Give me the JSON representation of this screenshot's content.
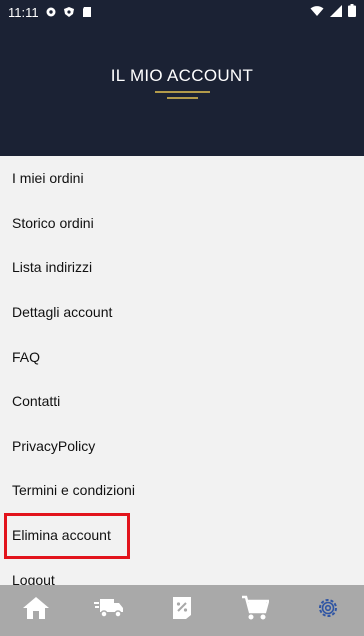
{
  "status_bar": {
    "time": "11:11",
    "icons_left": [
      "settings-icon",
      "shield-icon",
      "sd-card-icon"
    ],
    "icons_right": [
      "wifi-icon",
      "signal-icon",
      "battery-icon"
    ]
  },
  "header": {
    "title": "IL MIO ACCOUNT",
    "accent_color": "#b39b4a",
    "background_color": "#1b2234"
  },
  "menu": {
    "items": [
      {
        "label": "I miei ordini"
      },
      {
        "label": "Storico ordini"
      },
      {
        "label": "Lista indirizzi"
      },
      {
        "label": "Dettagli account"
      },
      {
        "label": "FAQ"
      },
      {
        "label": "Contatti"
      },
      {
        "label": "PrivacyPolicy"
      },
      {
        "label": "Termini e condizioni"
      },
      {
        "label": "Elimina account",
        "highlighted": true,
        "highlight_color": "#e2141c"
      },
      {
        "label": "Logout"
      }
    ]
  },
  "bottom_nav": {
    "items": [
      {
        "icon": "home-icon"
      },
      {
        "icon": "delivery-truck-icon"
      },
      {
        "icon": "discount-tag-icon"
      },
      {
        "icon": "shopping-cart-icon"
      },
      {
        "icon": "settings-gear-icon",
        "active": true,
        "active_color": "#2f55a4"
      }
    ]
  }
}
